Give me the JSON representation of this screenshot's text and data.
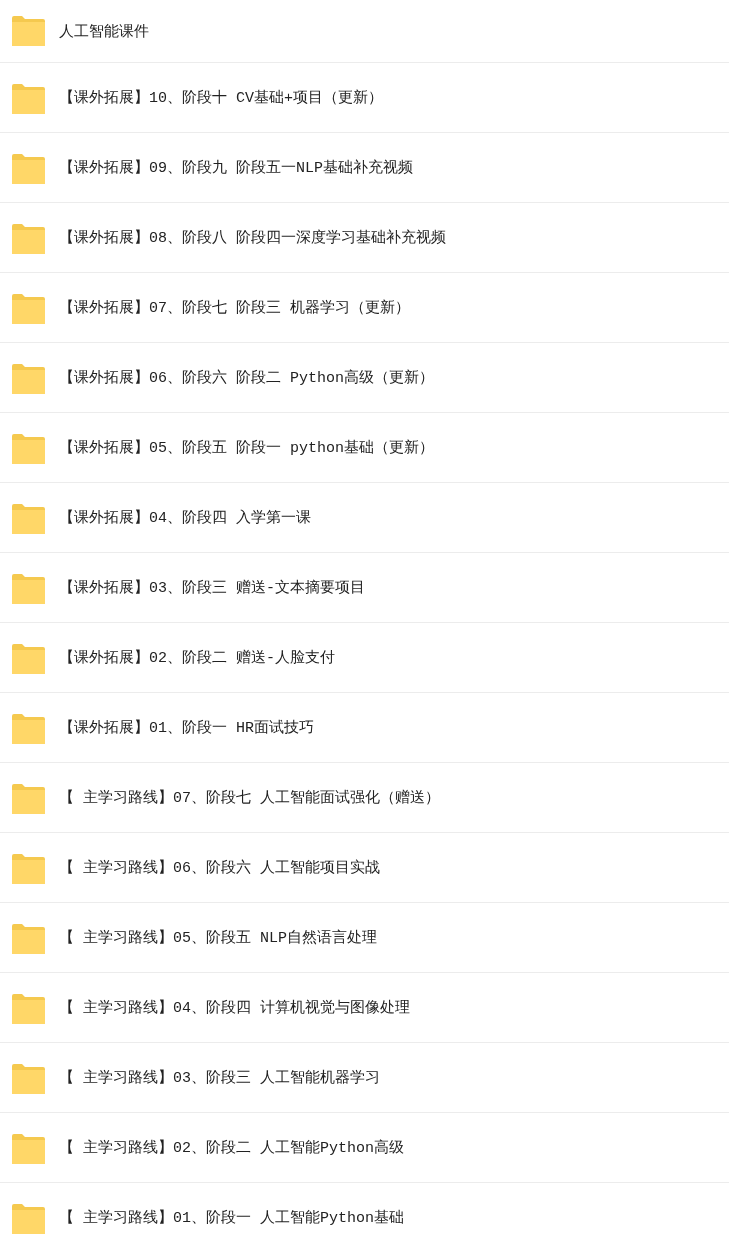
{
  "folders": [
    {
      "name": "人工智能课件"
    },
    {
      "name": "【课外拓展】10、阶段十 CV基础+项目（更新）"
    },
    {
      "name": "【课外拓展】09、阶段九 阶段五一NLP基础补充视频"
    },
    {
      "name": "【课外拓展】08、阶段八 阶段四一深度学习基础补充视频"
    },
    {
      "name": "【课外拓展】07、阶段七 阶段三 机器学习（更新）"
    },
    {
      "name": "【课外拓展】06、阶段六 阶段二 Python高级（更新）"
    },
    {
      "name": "【课外拓展】05、阶段五 阶段一 python基础（更新）"
    },
    {
      "name": "【课外拓展】04、阶段四 入学第一课"
    },
    {
      "name": "【课外拓展】03、阶段三 赠送-文本摘要项目"
    },
    {
      "name": "【课外拓展】02、阶段二 赠送-人脸支付"
    },
    {
      "name": "【课外拓展】01、阶段一 HR面试技巧"
    },
    {
      "name": "【 主学习路线】07、阶段七 人工智能面试强化（赠送）"
    },
    {
      "name": "【 主学习路线】06、阶段六 人工智能项目实战"
    },
    {
      "name": "【 主学习路线】05、阶段五 NLP自然语言处理"
    },
    {
      "name": "【 主学习路线】04、阶段四 计算机视觉与图像处理"
    },
    {
      "name": "【 主学习路线】03、阶段三 人工智能机器学习"
    },
    {
      "name": "【 主学习路线】02、阶段二 人工智能Python高级"
    },
    {
      "name": "【 主学习路线】01、阶段一 人工智能Python基础"
    }
  ]
}
